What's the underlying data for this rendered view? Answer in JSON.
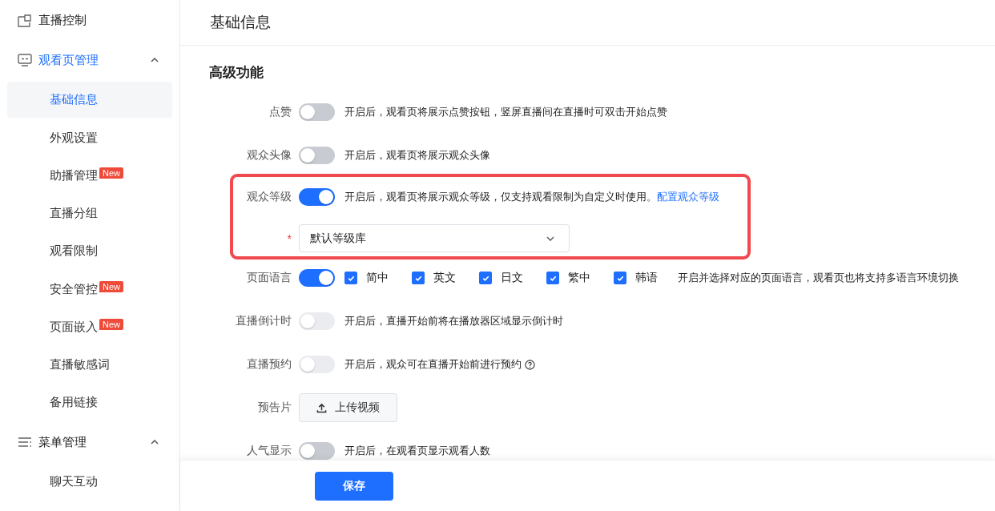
{
  "sidebar": {
    "groups": [
      {
        "label": "直播控制",
        "selected": false
      },
      {
        "label": "观看页管理",
        "expanded": true,
        "selected": true,
        "children": [
          {
            "label": "基础信息",
            "selected": true
          },
          {
            "label": "外观设置",
            "selected": false
          },
          {
            "label": "助播管理",
            "selected": false,
            "badge": "New"
          },
          {
            "label": "直播分组",
            "selected": false
          },
          {
            "label": "观看限制",
            "selected": false
          },
          {
            "label": "安全管控",
            "selected": false,
            "badge": "New"
          },
          {
            "label": "页面嵌入",
            "selected": false,
            "badge": "New"
          },
          {
            "label": "直播敏感词",
            "selected": false
          },
          {
            "label": "备用链接",
            "selected": false
          }
        ]
      },
      {
        "label": "菜单管理",
        "expanded": true,
        "selected": false,
        "children": [
          {
            "label": "聊天互动",
            "selected": false
          }
        ]
      }
    ]
  },
  "header": {
    "title": "基础信息"
  },
  "section": {
    "title": "高级功能"
  },
  "settings": [
    {
      "kind": "toggle",
      "label": "点赞",
      "on": false,
      "disabled": false,
      "description": "开启后，观看页将展示点赞按钮，竖屏直播间在直播时可双击开始点赞",
      "highlighted": false
    },
    {
      "kind": "toggle",
      "label": "观众头像",
      "on": false,
      "disabled": false,
      "description": "开启后，观看页将展示观众头像",
      "highlighted": false
    },
    {
      "kind": "toggle",
      "label": "观众等级",
      "on": true,
      "disabled": false,
      "description": "开启后，观看页将展示观众等级，仅支持观看限制为自定义时使用。",
      "link": "配置观众等级",
      "highlighted": true
    },
    {
      "kind": "select",
      "required_mark": "*",
      "value": "默认等级库",
      "highlighted": true
    },
    {
      "kind": "languages",
      "label": "页面语言",
      "on": true,
      "disabled": false,
      "options": [
        {
          "label": "简中",
          "checked": true
        },
        {
          "label": "英文",
          "checked": true
        },
        {
          "label": "日文",
          "checked": true
        },
        {
          "label": "繁中",
          "checked": true
        },
        {
          "label": "韩语",
          "checked": true
        }
      ],
      "description": "开启并选择对应的页面语言，观看页也将支持多语言环境切换",
      "highlighted": false
    },
    {
      "kind": "toggle",
      "label": "直播倒计时",
      "on": false,
      "disabled": true,
      "description": "开启后，直播开始前将在播放器区域显示倒计时",
      "highlighted": false
    },
    {
      "kind": "toggle",
      "label": "直播预约",
      "on": false,
      "disabled": true,
      "description": "开启后，观众可在直播开始前进行预约",
      "help": true,
      "highlighted": false
    },
    {
      "kind": "upload",
      "label": "预告片",
      "button": "上传视频",
      "highlighted": false
    },
    {
      "kind": "toggle",
      "label": "人气显示",
      "on": false,
      "disabled": false,
      "description": "开启后，在观看页显示观看人数",
      "highlighted": false
    }
  ],
  "footer": {
    "save": "保存"
  }
}
